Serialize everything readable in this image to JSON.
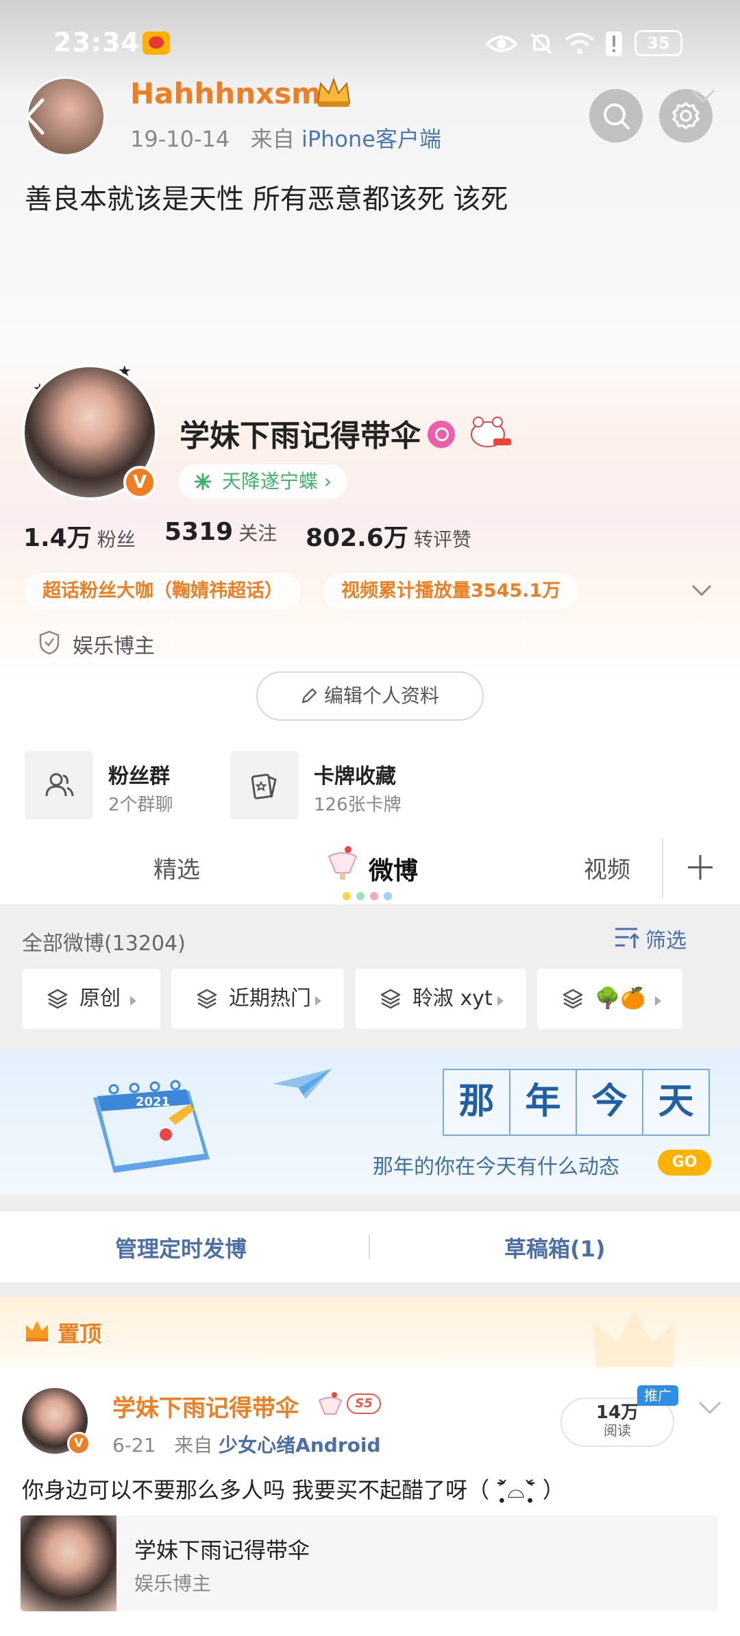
{
  "status_bar": {
    "time": "23:34",
    "battery": "35"
  },
  "top_post": {
    "username": "Hahhhnxsm",
    "date": "19-10-14",
    "from_label": "来自",
    "source": "iPhone客户端",
    "text": "善良本就该是天性  所有恶意都该死 该死"
  },
  "profile": {
    "name": "学妹下雨记得带伞",
    "title_badge": "天降遂宁蝶 ›",
    "verified_mark": "V",
    "stats": [
      {
        "value": "1.4万",
        "label": "粉丝"
      },
      {
        "value": "5319",
        "label": "关注"
      },
      {
        "value": "802.6万",
        "label": "转评赞"
      }
    ],
    "tags": [
      "超话粉丝大咖（鞠婧祎超话）",
      "视频累计播放量3545.1万"
    ],
    "category": "娱乐博主",
    "edit_button": "编辑个人资料"
  },
  "features": [
    {
      "title": "粉丝群",
      "subtitle": "2个群聊"
    },
    {
      "title": "卡牌收藏",
      "subtitle": "126张卡牌"
    }
  ],
  "tabs": {
    "featured": "精选",
    "weibo": "微博",
    "video": "视频"
  },
  "feed": {
    "all_count": "全部微博(13204)",
    "filter": "筛选",
    "chips": [
      "原创",
      "近期热门",
      "聆淑 xyt",
      "🌳🍊"
    ]
  },
  "banner": {
    "title_chars": [
      "那",
      "年",
      "今",
      "天"
    ],
    "subtitle": "那年的你在今天有什么动态",
    "go": "GO",
    "calendar_year": "2021"
  },
  "manage": {
    "scheduled": "管理定时发博",
    "drafts": "草稿箱(1)"
  },
  "pinned": {
    "label": "置顶",
    "author": "学妹下雨记得带伞",
    "level": "S5",
    "date": "6-21",
    "from_label": "来自",
    "source": "少女心绪Android",
    "reads_value": "14万",
    "reads_label": "阅读",
    "promo": "推广",
    "text": "你身边可以不要那么多人吗 我要买不起醋了呀（ ˃̣̣̥᷄⌓˂̣̣̥᷅ ）",
    "card_title": "学妹下雨记得带伞",
    "card_subtitle": "娱乐博主"
  },
  "colors": {
    "accent_orange": "#f07d1f",
    "link_blue": "#4a6fa8",
    "green": "#3fb36a"
  }
}
